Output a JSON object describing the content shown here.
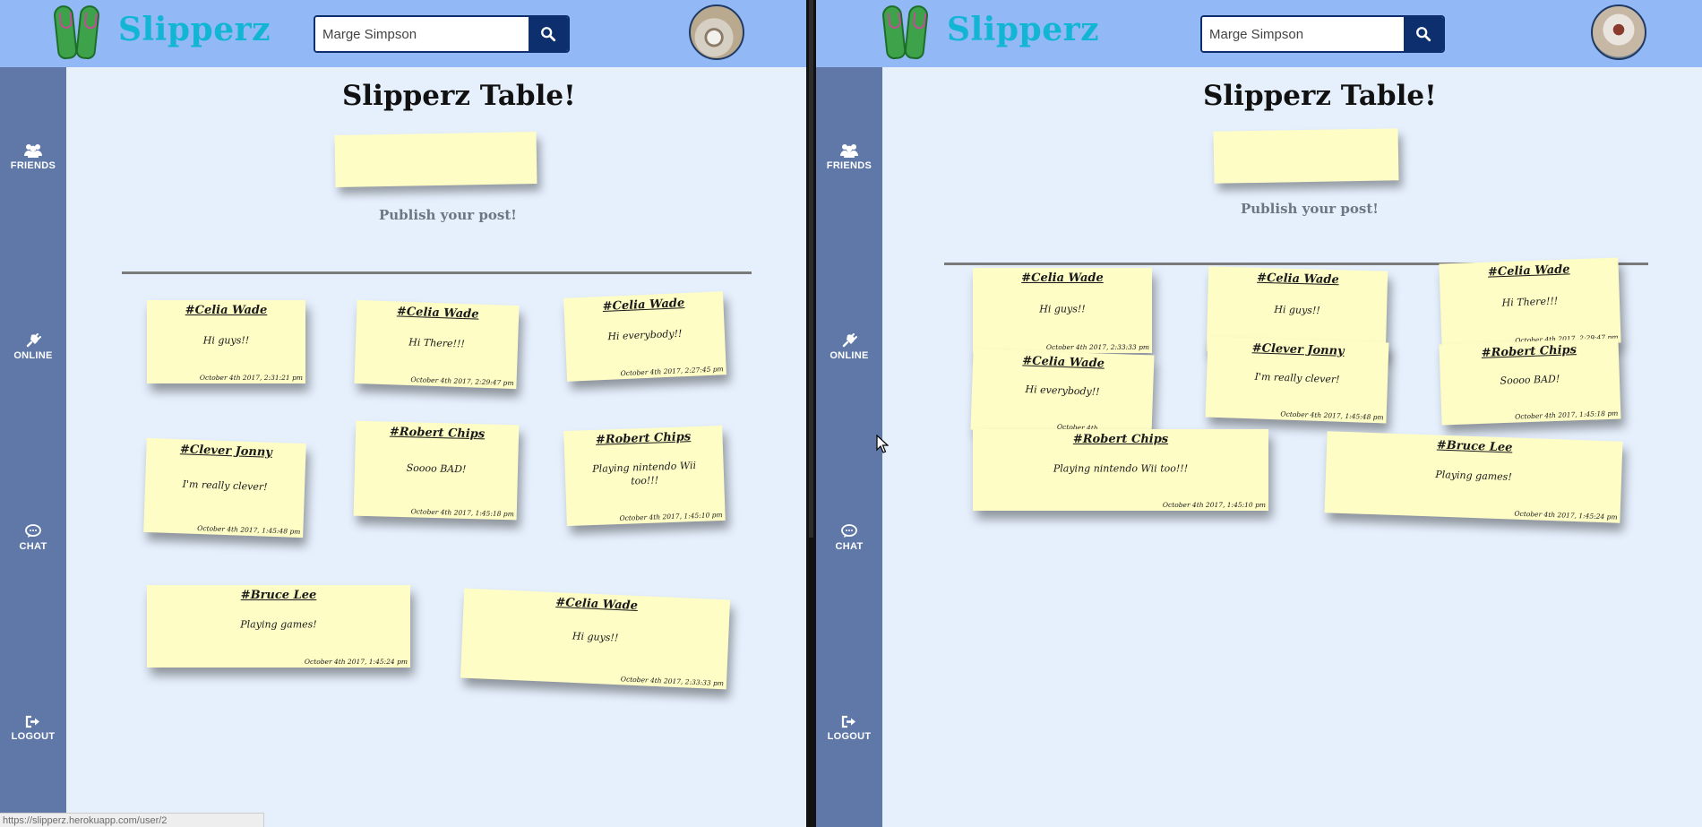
{
  "app": {
    "name": "Slipperz"
  },
  "search": {
    "value": "Marge Simpson"
  },
  "nav": [
    {
      "label": "FRIENDS",
      "icon": "users-icon"
    },
    {
      "label": "ONLINE",
      "icon": "plug-icon"
    },
    {
      "label": "CHAT",
      "icon": "chat-bubble-icon"
    },
    {
      "label": "LOGOUT",
      "icon": "sign-out-icon"
    }
  ],
  "table": {
    "title": "Slipperz Table!",
    "publish_label": "Publish your post!"
  },
  "left_notes": [
    {
      "author": "#Celia Wade",
      "message": "Hi guys!!",
      "timestamp": "October 4th 2017, 2:31:21 pm"
    },
    {
      "author": "#Celia Wade",
      "message": "Hi There!!!",
      "timestamp": "October 4th 2017, 2:29:47 pm"
    },
    {
      "author": "#Celia Wade",
      "message": "Hi everybody!!",
      "timestamp": "October 4th 2017, 2:27:45 pm"
    },
    {
      "author": "#Clever Jonny",
      "message": "I'm really clever!",
      "timestamp": "October 4th 2017, 1:45:48 pm"
    },
    {
      "author": "#Robert Chips",
      "message": "Soooo BAD!",
      "timestamp": "October 4th 2017, 1:45:18 pm"
    },
    {
      "author": "#Robert Chips",
      "message": "Playing nintendo Wii too!!!",
      "timestamp": "October 4th 2017, 1:45:10 pm"
    },
    {
      "author": "#Bruce Lee",
      "message": "Playing games!",
      "timestamp": "October 4th 2017, 1:45:24 pm"
    },
    {
      "author": "#Celia Wade",
      "message": "Hi guys!!",
      "timestamp": "October 4th 2017, 2:33:33 pm"
    }
  ],
  "right_notes": [
    {
      "author": "#Celia Wade",
      "message": "Hi guys!!",
      "timestamp": "October 4th 2017, 2:33:33 pm"
    },
    {
      "author": "#Celia Wade",
      "message": "Hi guys!!",
      "timestamp": ""
    },
    {
      "author": "#Celia Wade",
      "message": "Hi There!!!",
      "timestamp": "October 4th 2017, 2:29:47 pm"
    },
    {
      "author": "#Celia Wade",
      "message": "Hi everybody!!",
      "timestamp": "October 4th"
    },
    {
      "author": "#Clever Jonny",
      "message": "I'm really clever!",
      "timestamp": "October 4th 2017, 1:45:48 pm"
    },
    {
      "author": "#Robert Chips",
      "message": "Soooo BAD!",
      "timestamp": "October 4th 2017, 1:45:18 pm"
    },
    {
      "author": "#Robert Chips",
      "message": "Playing nintendo Wii too!!!",
      "timestamp": "October 4th 2017, 1:45:10 pm"
    },
    {
      "author": "#Bruce Lee",
      "message": "Playing games!",
      "timestamp": "October 4th 2017, 1:45:24 pm"
    }
  ],
  "status_url": "https://slipperz.herokuapp.com/user/2",
  "colors": {
    "topbar": "#93b8f6",
    "sidebar": "#5f78a8",
    "background": "#e6f0fd",
    "note": "#fefdc6",
    "search_button": "#0d2f6e",
    "logo_text": "#13b5d4"
  }
}
